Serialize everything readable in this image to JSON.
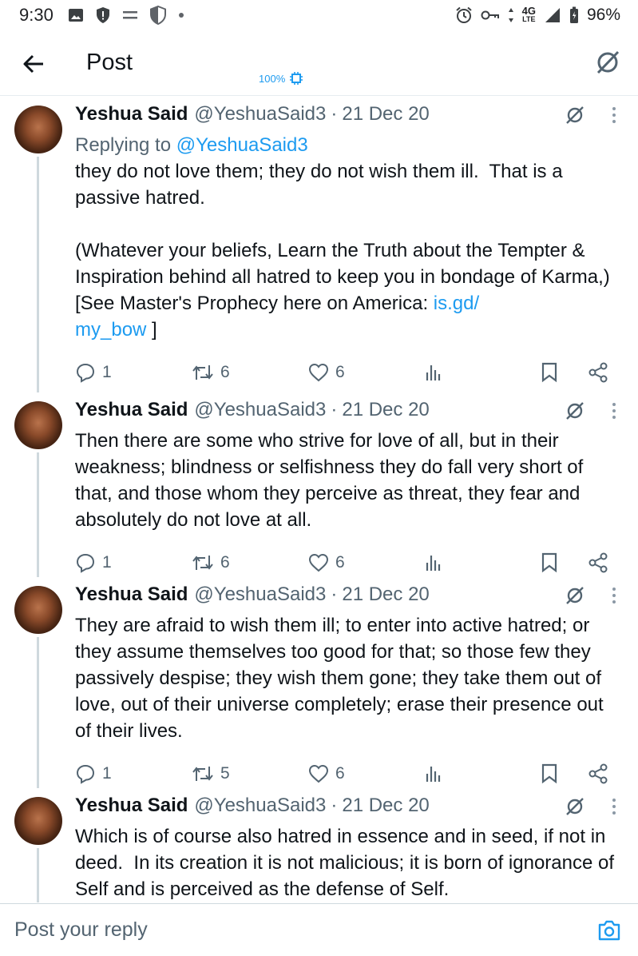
{
  "status_bar": {
    "time": "9:30",
    "network": "4G",
    "network_sub": "LTE",
    "battery": "96%",
    "icons": [
      "image-icon",
      "shield-icon",
      "equals-icon",
      "shield-icon",
      "dot-icon",
      "alarm-icon",
      "key-icon",
      "signal-icon",
      "battery-icon"
    ]
  },
  "header": {
    "title": "Post",
    "zoom": "100%"
  },
  "colors": {
    "accent": "#1d9bf0",
    "text": "#0f1419",
    "muted": "#536471",
    "divider": "#cfd9de"
  },
  "tweets": [
    {
      "author": "Yeshua Said",
      "handle": "@YeshuaSaid3",
      "separator": "·",
      "date": "21 Dec 20",
      "reply_prefix": "Replying to",
      "reply_handle": "@YeshuaSaid3",
      "text": "they do not love them; they do not wish them ill.  That is a passive hatred.\n\n(Whatever your beliefs, Learn the Truth about the Tempter & Inspiration behind all hatred to keep you in bondage of Karma,) [See Master's Prophecy here on America: ",
      "link": "is.gd/\nmy_bow",
      "text_after": " ]",
      "replies": "1",
      "reposts": "6",
      "likes": "6"
    },
    {
      "author": "Yeshua Said",
      "handle": "@YeshuaSaid3",
      "separator": "·",
      "date": "21 Dec 20",
      "text": "Then there are some who strive for love of all, but in their weakness; blindness or selfishness they do fall very short of that, and those whom they perceive as threat, they fear and absolutely do not love at all.",
      "replies": "1",
      "reposts": "6",
      "likes": "6"
    },
    {
      "author": "Yeshua Said",
      "handle": "@YeshuaSaid3",
      "separator": "·",
      "date": "21 Dec 20",
      "text": "They are afraid to wish them ill; to enter into active hatred; or they assume themselves too good for that; so those few they passively despise; they wish them gone; they take them out of love, out of their universe completely; erase their presence out of their lives.",
      "replies": "1",
      "reposts": "5",
      "likes": "6"
    },
    {
      "author": "Yeshua Said",
      "handle": "@YeshuaSaid3",
      "separator": "·",
      "date": "21 Dec 20",
      "text": "Which is of course also hatred in essence and in seed, if not in deed.  In its creation it is not malicious; it is born of ignorance of Self and is perceived as the defense of Self."
    }
  ],
  "reply_bar": {
    "placeholder": "Post your reply"
  }
}
